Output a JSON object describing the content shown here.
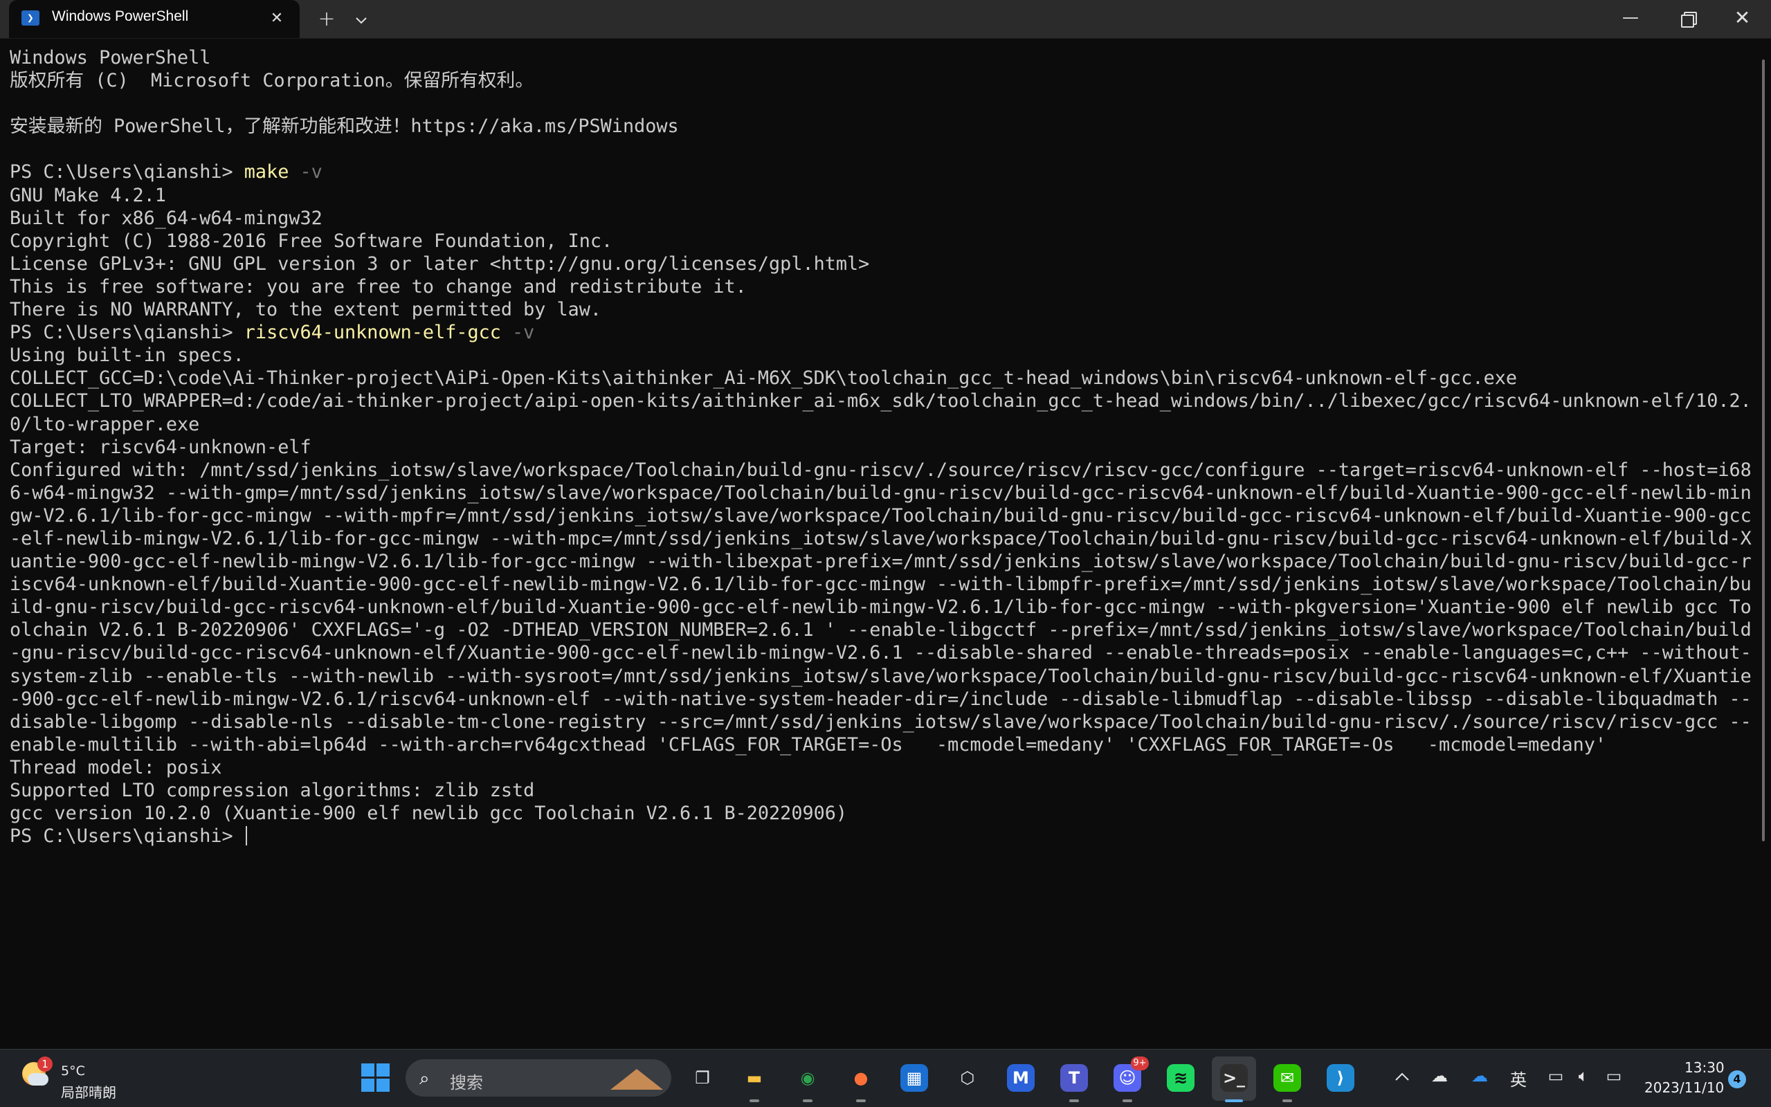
{
  "window": {
    "tab_title": "Windows PowerShell",
    "new_tab_label": "+",
    "dropdown_label": "⌄",
    "close_tab_label": "✕",
    "minimize_label": "—",
    "close_label": "✕"
  },
  "terminal": {
    "prompt": "PS C:\\Users\\qianshi> ",
    "lines": [
      "Windows PowerShell",
      "版权所有 (C)  Microsoft Corporation。保留所有权利。",
      "",
      "安装最新的 PowerShell，了解新功能和改进！https://aka.ms/PSWindows",
      "",
      {
        "cmd": "make",
        "args": " -v"
      },
      "GNU Make 4.2.1",
      "Built for x86_64-w64-mingw32",
      "Copyright (C) 1988-2016 Free Software Foundation, Inc.",
      "License GPLv3+: GNU GPL version 3 or later <http://gnu.org/licenses/gpl.html>",
      "This is free software: you are free to change and redistribute it.",
      "There is NO WARRANTY, to the extent permitted by law.",
      {
        "cmd": "riscv64-unknown-elf-gcc",
        "args": " -v"
      },
      "Using built-in specs.",
      "COLLECT_GCC=D:\\code\\Ai-Thinker-project\\AiPi-Open-Kits\\aithinker_Ai-M6X_SDK\\toolchain_gcc_t-head_windows\\bin\\riscv64-unknown-elf-gcc.exe",
      "COLLECT_LTO_WRAPPER=d:/code/ai-thinker-project/aipi-open-kits/aithinker_ai-m6x_sdk/toolchain_gcc_t-head_windows/bin/../libexec/gcc/riscv64-unknown-elf/10.2.",
      "0/lto-wrapper.exe",
      "Target: riscv64-unknown-elf",
      "Configured with: /mnt/ssd/jenkins_iotsw/slave/workspace/Toolchain/build-gnu-riscv/./source/riscv/riscv-gcc/configure --target=riscv64-unknown-elf --host=i68",
      "6-w64-mingw32 --with-gmp=/mnt/ssd/jenkins_iotsw/slave/workspace/Toolchain/build-gnu-riscv/build-gcc-riscv64-unknown-elf/build-Xuantie-900-gcc-elf-newlib-min",
      "gw-V2.6.1/lib-for-gcc-mingw --with-mpfr=/mnt/ssd/jenkins_iotsw/slave/workspace/Toolchain/build-gnu-riscv/build-gcc-riscv64-unknown-elf/build-Xuantie-900-gcc",
      "-elf-newlib-mingw-V2.6.1/lib-for-gcc-mingw --with-mpc=/mnt/ssd/jenkins_iotsw/slave/workspace/Toolchain/build-gnu-riscv/build-gcc-riscv64-unknown-elf/build-X",
      "uantie-900-gcc-elf-newlib-mingw-V2.6.1/lib-for-gcc-mingw --with-libexpat-prefix=/mnt/ssd/jenkins_iotsw/slave/workspace/Toolchain/build-gnu-riscv/build-gcc-r",
      "iscv64-unknown-elf/build-Xuantie-900-gcc-elf-newlib-mingw-V2.6.1/lib-for-gcc-mingw --with-libmpfr-prefix=/mnt/ssd/jenkins_iotsw/slave/workspace/Toolchain/bu",
      "ild-gnu-riscv/build-gcc-riscv64-unknown-elf/build-Xuantie-900-gcc-elf-newlib-mingw-V2.6.1/lib-for-gcc-mingw --with-pkgversion='Xuantie-900 elf newlib gcc To",
      "olchain V2.6.1 B-20220906' CXXFLAGS='-g -O2 -DTHEAD_VERSION_NUMBER=2.6.1 ' --enable-libgcctf --prefix=/mnt/ssd/jenkins_iotsw/slave/workspace/Toolchain/build",
      "-gnu-riscv/build-gcc-riscv64-unknown-elf/Xuantie-900-gcc-elf-newlib-mingw-V2.6.1 --disable-shared --enable-threads=posix --enable-languages=c,c++ --without-",
      "system-zlib --enable-tls --with-newlib --with-sysroot=/mnt/ssd/jenkins_iotsw/slave/workspace/Toolchain/build-gnu-riscv/build-gcc-riscv64-unknown-elf/Xuantie",
      "-900-gcc-elf-newlib-mingw-V2.6.1/riscv64-unknown-elf --with-native-system-header-dir=/include --disable-libmudflap --disable-libssp --disable-libquadmath --",
      "disable-libgomp --disable-nls --disable-tm-clone-registry --src=/mnt/ssd/jenkins_iotsw/slave/workspace/Toolchain/build-gnu-riscv/./source/riscv/riscv-gcc --",
      "enable-multilib --with-abi=lp64d --with-arch=rv64gcxthead 'CFLAGS_FOR_TARGET=-Os   -mcmodel=medany' 'CXXFLAGS_FOR_TARGET=-Os   -mcmodel=medany'",
      "Thread model: posix",
      "Supported LTO compression algorithms: zlib zstd",
      "gcc version 10.2.0 (Xuantie-900 elf newlib gcc Toolchain V2.6.1 B-20220906)",
      {
        "cmd": "",
        "args": "",
        "cursor": true
      }
    ]
  },
  "taskbar": {
    "weather": {
      "badge": "1",
      "temp": "5°C",
      "desc": "局部晴朗"
    },
    "search_placeholder": "搜索",
    "apps": [
      {
        "name": "task-view-icon",
        "glyph": "❐",
        "color": "#e8e8e8",
        "bg": "transparent",
        "running": false
      },
      {
        "name": "file-explorer-icon",
        "glyph": "▬",
        "color": "#f5c242",
        "bg": "transparent",
        "running": true
      },
      {
        "name": "chrome-icon",
        "glyph": "◉",
        "color": "#2fa44f",
        "bg": "transparent",
        "running": true
      },
      {
        "name": "firefox-icon",
        "glyph": "●",
        "color": "#ff7139",
        "bg": "transparent",
        "running": true
      },
      {
        "name": "microsoft-store-icon",
        "glyph": "▦",
        "color": "#ffffff",
        "bg": "#1b6fd1",
        "running": false
      },
      {
        "name": "unity-icon",
        "glyph": "⬡",
        "color": "#e8e8e8",
        "bg": "transparent",
        "running": false
      },
      {
        "name": "app-m-icon",
        "glyph": "M",
        "color": "#ffffff",
        "bg": "#2b62d9",
        "running": false
      },
      {
        "name": "teams-icon",
        "glyph": "T",
        "color": "#ffffff",
        "bg": "#5059c9",
        "running": true
      },
      {
        "name": "discord-icon",
        "glyph": "☺",
        "color": "#ffffff",
        "bg": "#5865f2",
        "running": true,
        "badge": "9+"
      },
      {
        "name": "spotify-icon",
        "glyph": "≋",
        "color": "#111111",
        "bg": "#1ed760",
        "running": false
      },
      {
        "name": "terminal-icon",
        "glyph": ">_",
        "color": "#e8e8e8",
        "bg": "#2e2e2e",
        "running": true,
        "active": true
      },
      {
        "name": "wechat-icon",
        "glyph": "✉",
        "color": "#ffffff",
        "bg": "#2dc100",
        "running": true
      },
      {
        "name": "vscode-icon",
        "glyph": "⟩",
        "color": "#ffffff",
        "bg": "#1f8ad2",
        "running": false
      }
    ],
    "tray": {
      "chevron": "^",
      "ime": "英",
      "time": "13:30",
      "date": "2023/11/10",
      "notifications": "4"
    }
  },
  "colors": {
    "terminal_bg": "#0c0c0c",
    "terminal_fg": "#cccccc",
    "command": "#f9f1a5",
    "argument": "#767676",
    "accent": "#5fb2f2"
  }
}
